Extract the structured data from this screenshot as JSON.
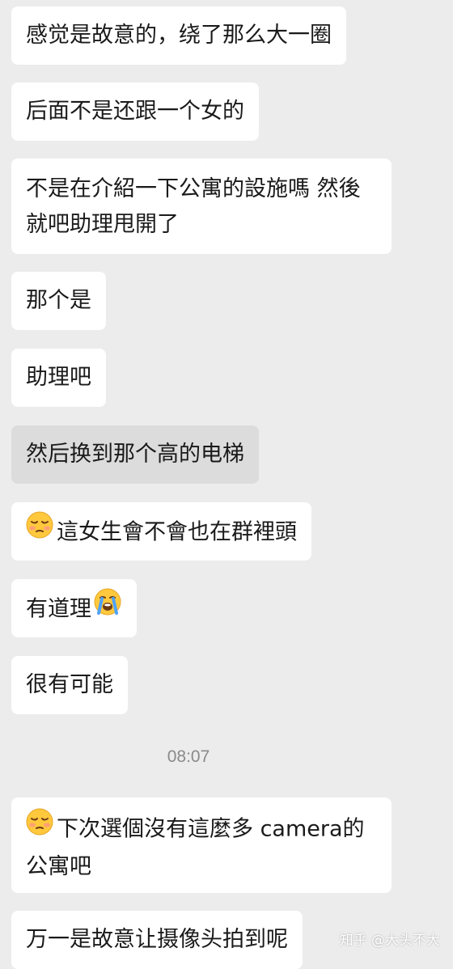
{
  "messages": [
    {
      "text": "感觉是故意的，绕了那么大一圈"
    },
    {
      "text": "后面不是还跟一个女的"
    },
    {
      "text": "不是在介紹一下公寓的設施嗎 然後就吧助理甩開了"
    },
    {
      "text": "那个是"
    },
    {
      "text": "助理吧"
    },
    {
      "text": "然后换到那个高的电梯"
    },
    {
      "text": "這女生會不會也在群裡頭",
      "emoji_before": "pensive-face-icon"
    },
    {
      "text": "有道理",
      "emoji_after": "loudly-crying-face-icon"
    },
    {
      "text": "很有可能"
    },
    {
      "text": "下次選個沒有這麼多 camera的公寓吧",
      "emoji_before": "pensive-face-icon"
    },
    {
      "text": "万一是故意让摄像头拍到呢"
    }
  ],
  "timestamp": "08:07",
  "watermark": "知乎 @大头不大",
  "colors": {
    "background": "#ececec",
    "bubble": "#ffffff",
    "bubble_pressed": "#dcdcdc",
    "text": "#1a1a1a",
    "timestamp": "#8a8a8a"
  }
}
